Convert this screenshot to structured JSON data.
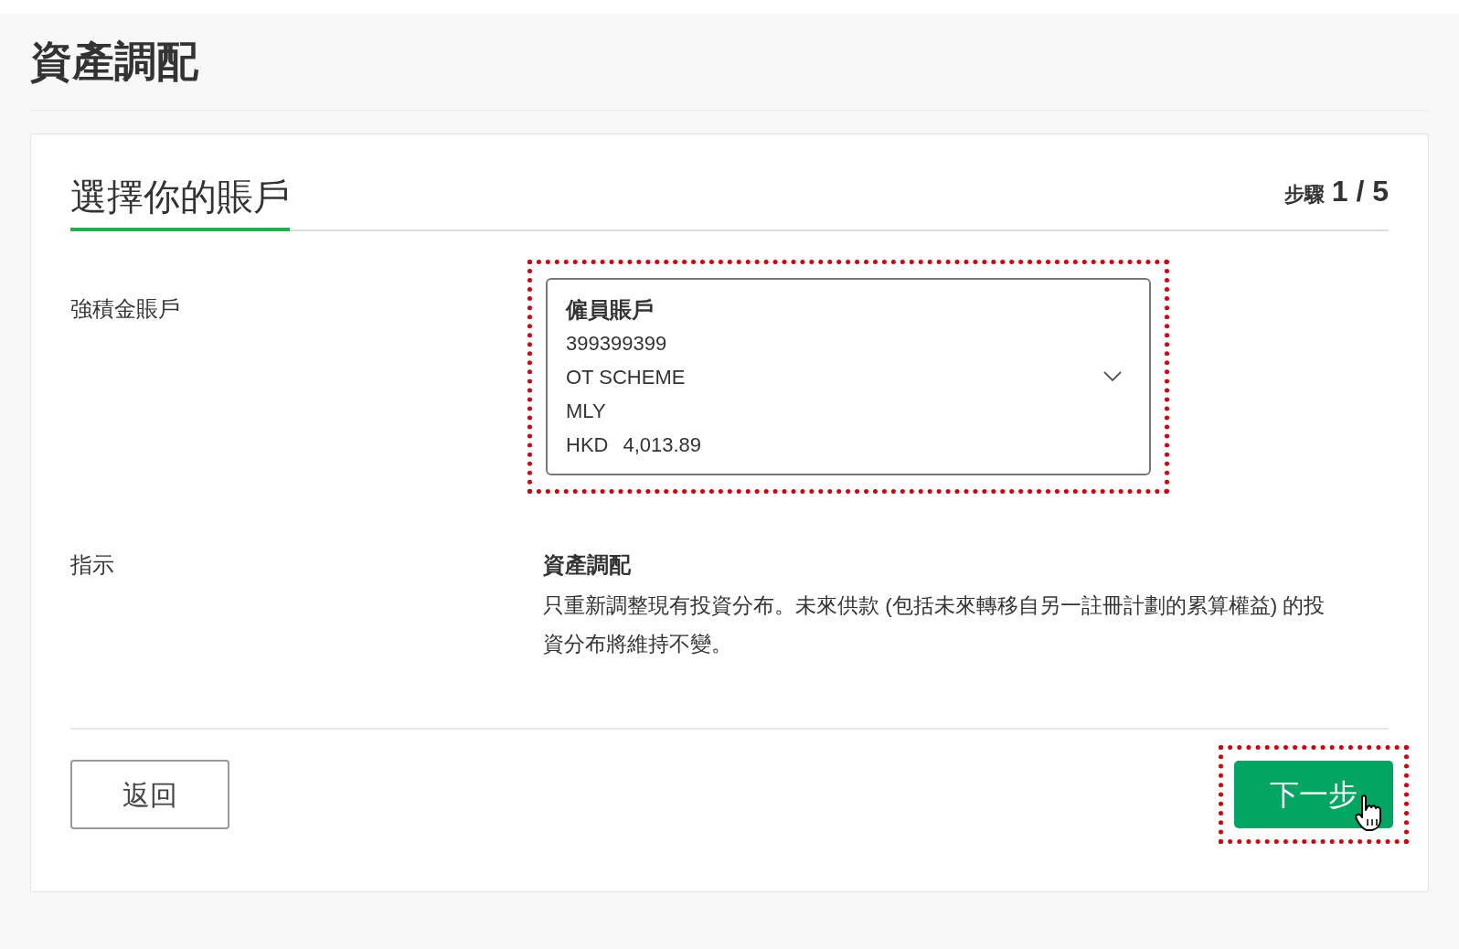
{
  "page": {
    "title": "資產調配"
  },
  "card": {
    "heading": "選擇你的賬戶",
    "step_label": "步驟",
    "step_value": "1 / 5"
  },
  "account_row": {
    "label": "強積金賬戶",
    "highlighted": true,
    "select": {
      "account_type": "僱員賬戶",
      "account_number": "399399399",
      "scheme": "OT SCHEME",
      "code": "MLY",
      "currency": "HKD",
      "balance": "4,013.89"
    }
  },
  "instruction_row": {
    "label": "指示",
    "title": "資產調配",
    "text": "只重新調整現有投資分布。未來供款 (包括未來轉移自另一註冊計劃的累算權益) 的投資分布將維持不變。"
  },
  "buttons": [
    {
      "kind": "secondary",
      "label": "返回"
    },
    {
      "kind": "primary",
      "label": "下一步",
      "highlighted": true
    }
  ]
}
